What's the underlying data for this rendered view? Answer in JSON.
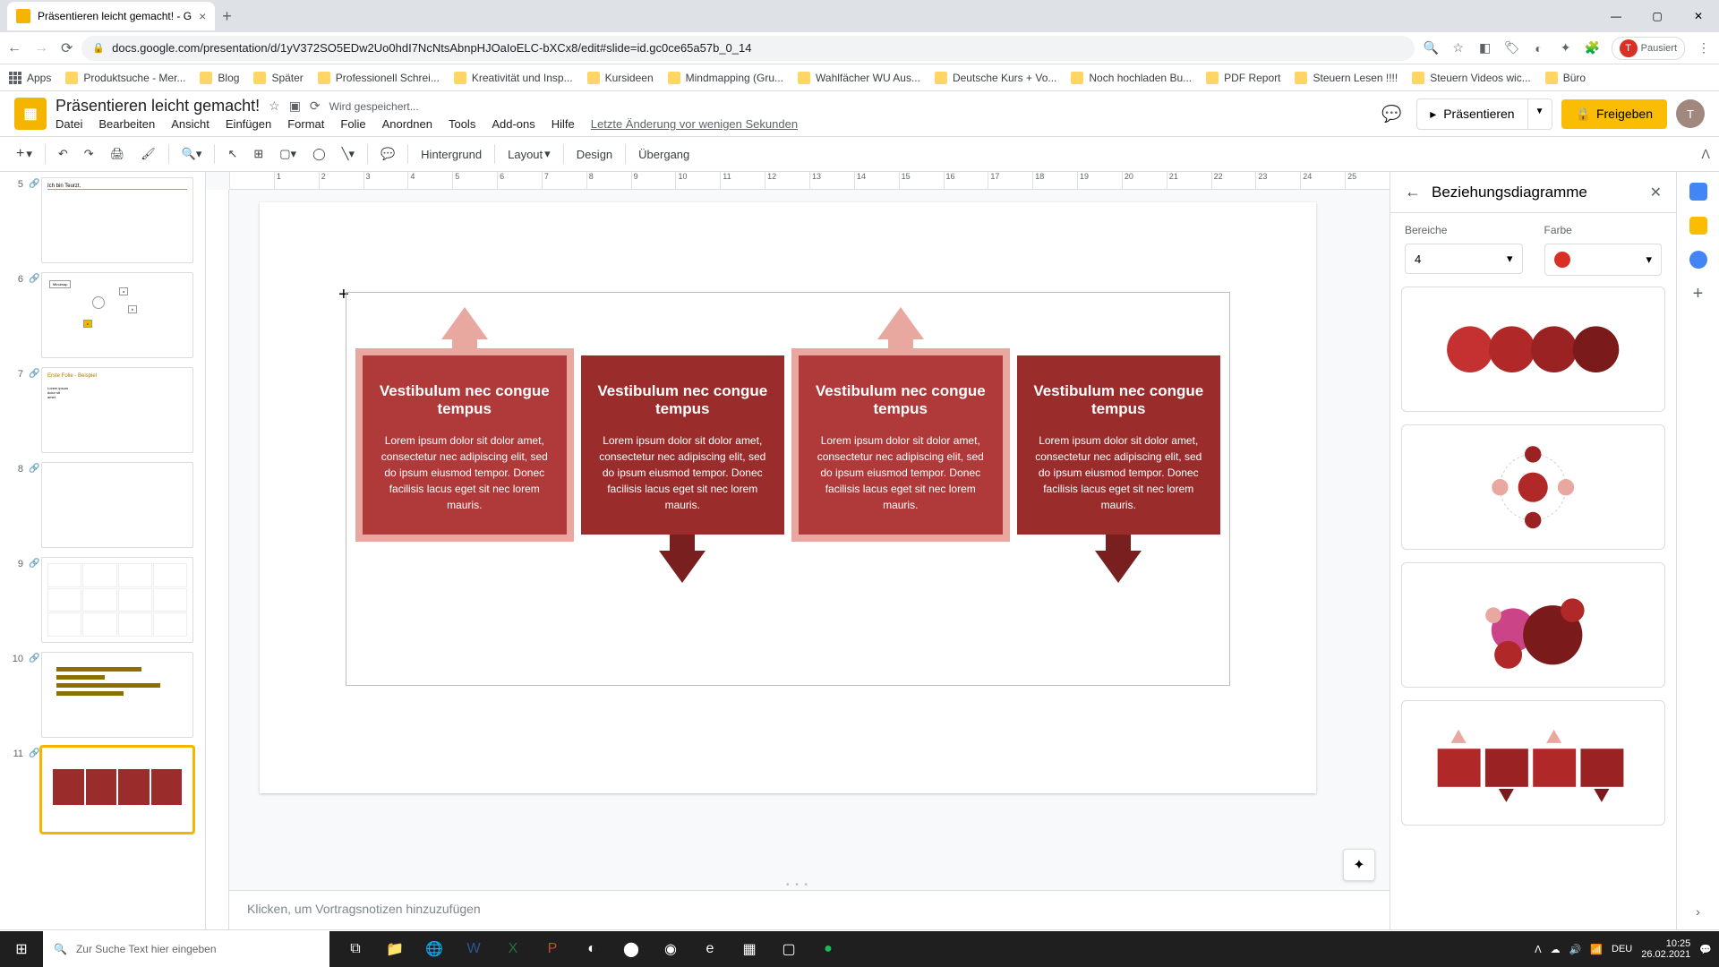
{
  "browser": {
    "tab_title": "Präsentieren leicht gemacht! - G",
    "url": "docs.google.com/presentation/d/1yV372SO5EDw2Uo0hdI7NcNtsAbnpHJOaIoELC-bXCx8/edit#slide=id.gc0ce65a57b_0_14",
    "pause_label": "Pausiert"
  },
  "bookmarks": [
    "Apps",
    "Produktsuche - Mer...",
    "Blog",
    "Später",
    "Professionell Schrei...",
    "Kreativität und Insp...",
    "Kursideen",
    "Mindmapping (Gru...",
    "Wahlfächer WU Aus...",
    "Deutsche Kurs + Vo...",
    "Noch hochladen Bu...",
    "PDF Report",
    "Steuern Lesen !!!!",
    "Steuern Videos wic...",
    "Büro"
  ],
  "doc": {
    "title": "Präsentieren leicht gemacht!",
    "saving": "Wird gespeichert...",
    "last_edit": "Letzte Änderung vor wenigen Sekunden"
  },
  "menus": [
    "Datei",
    "Bearbeiten",
    "Ansicht",
    "Einfügen",
    "Format",
    "Folie",
    "Anordnen",
    "Tools",
    "Add-ons",
    "Hilfe"
  ],
  "actions": {
    "present": "Präsentieren",
    "share": "Freigeben"
  },
  "toolbar": {
    "background": "Hintergrund",
    "layout": "Layout",
    "design": "Design",
    "transition": "Übergang"
  },
  "side_panel": {
    "title": "Beziehungsdiagramme",
    "areas_label": "Bereiche",
    "areas_value": "4",
    "color_label": "Farbe"
  },
  "thumbs": [
    {
      "num": "5",
      "kind": "text"
    },
    {
      "num": "6",
      "kind": "mindmap"
    },
    {
      "num": "7",
      "kind": "text2"
    },
    {
      "num": "8",
      "kind": "blank"
    },
    {
      "num": "9",
      "kind": "table"
    },
    {
      "num": "10",
      "kind": "chart"
    },
    {
      "num": "11",
      "kind": "diagram",
      "selected": true
    }
  ],
  "diagram": {
    "cards": [
      {
        "title": "Vestibulum nec congue tempus",
        "body": "Lorem ipsum dolor sit dolor amet, consectetur nec adipiscing elit, sed do ipsum eiusmod tempor. Donec facilisis lacus eget sit nec lorem mauris."
      },
      {
        "title": "Vestibulum nec congue tempus",
        "body": "Lorem ipsum dolor sit dolor amet, consectetur nec adipiscing elit, sed do ipsum eiusmod tempor. Donec facilisis lacus eget sit nec lorem mauris."
      },
      {
        "title": "Vestibulum nec congue tempus",
        "body": "Lorem ipsum dolor sit dolor amet, consectetur nec adipiscing elit, sed do ipsum eiusmod tempor. Donec facilisis lacus eget sit nec lorem mauris."
      },
      {
        "title": "Vestibulum nec congue tempus",
        "body": "Lorem ipsum dolor sit dolor amet, consectetur nec adipiscing elit, sed do ipsum eiusmod tempor. Donec facilisis lacus eget sit nec lorem mauris."
      }
    ]
  },
  "notes_placeholder": "Klicken, um Vortragsnotizen hinzuzufügen",
  "taskbar": {
    "search_placeholder": "Zur Suche Text hier eingeben",
    "lang": "DEU",
    "time": "10:25",
    "date": "26.02.2021"
  },
  "ruler_ticks": [
    "",
    "1",
    "2",
    "3",
    "4",
    "5",
    "6",
    "7",
    "8",
    "9",
    "10",
    "11",
    "12",
    "13",
    "14",
    "15",
    "16",
    "17",
    "18",
    "19",
    "20",
    "21",
    "22",
    "23",
    "24",
    "25"
  ]
}
